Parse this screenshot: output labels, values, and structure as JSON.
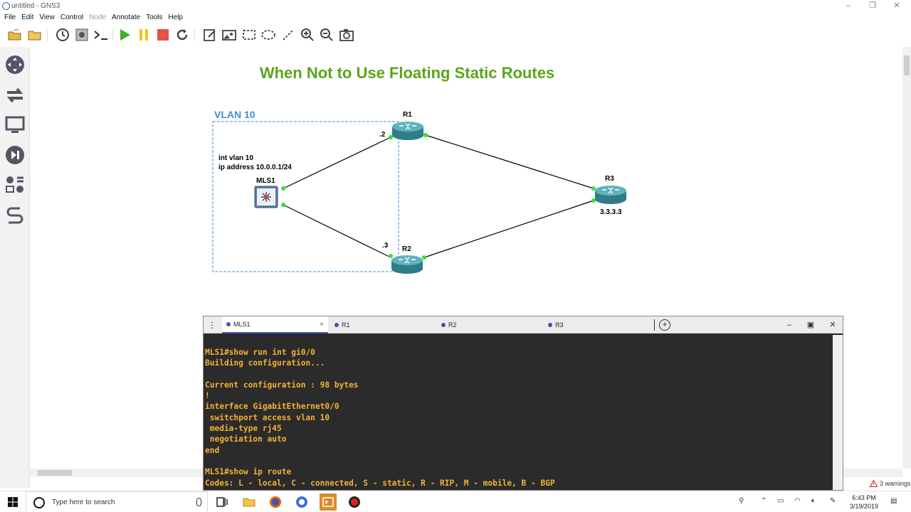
{
  "window": {
    "title": "untitled - GNS3",
    "minimize": "–",
    "restore": "❐",
    "close": "✕"
  },
  "menu": [
    "File",
    "Edit",
    "View",
    "Control",
    "Node",
    "Annotate",
    "Tools",
    "Help"
  ],
  "menu_disabled_index": 4,
  "toolbar_icons": [
    "open-project-icon",
    "open-folder-icon",
    "snapshot-icon",
    "device-screenshot-icon",
    "console-all-icon",
    "start-icon",
    "suspend-icon",
    "stop-icon",
    "reload-icon",
    "add-note-icon",
    "insert-picture-icon",
    "draw-rectangle-icon",
    "draw-ellipse-icon",
    "draw-line-icon",
    "zoom-in-icon",
    "zoom-out-icon",
    "screenshot-icon"
  ],
  "dock_icons": [
    "browse-routers-icon",
    "browse-switches-icon",
    "browse-end-devices-icon",
    "browse-security-devices-icon",
    "browse-all-devices-icon",
    "add-link-icon"
  ],
  "topology": {
    "title": "When Not to Use Floating Static Routes",
    "vlan_label": "VLAN 10",
    "mls_config_line1": "int vlan 10",
    "mls_config_line2": "ip address 10.0.0.1/24",
    "nodes": {
      "mls1": "MLS1",
      "r1": "R1",
      "r2": "R2",
      "r3": "R3"
    },
    "port_labels": {
      "r1": ".2",
      "r2": ".3"
    },
    "r3_address": "3.3.3.3",
    "colors": {
      "title": "#5aa51a",
      "vlan": "#3f8fd2",
      "router": "#2e7d87",
      "link": "#000000",
      "port_up": "#2ee52e"
    }
  },
  "console": {
    "tabs": [
      {
        "label": "MLS1",
        "close": "×"
      },
      {
        "label": "R1"
      },
      {
        "label": "R2"
      },
      {
        "label": "R3"
      }
    ],
    "add_tab": "+",
    "menu": "⋮",
    "minimize": "–",
    "maximize": "▣",
    "close": "✕",
    "text_color": "#f2b233",
    "lines": [
      "MLS1#show run int gi0/0",
      "Building configuration...",
      "",
      "Current configuration : 98 bytes",
      "!",
      "interface GigabitEthernet0/0",
      " switchport access vlan 10",
      " media-type rj45",
      " negotiation auto",
      "end",
      "",
      "MLS1#show ip route",
      "Codes: L - local, C - connected, S - static, R - RIP, M - mobile, B - BGP"
    ]
  },
  "status": {
    "warnings": "3 warnings"
  },
  "taskbar": {
    "search_placeholder": "Type here to search",
    "time": "6:43 PM",
    "date": "3/19/2019",
    "apps": [
      "task-view-icon",
      "file-explorer-icon",
      "firefox-icon",
      "gns3-icon",
      "terminal-app-icon",
      "record-icon"
    ]
  }
}
